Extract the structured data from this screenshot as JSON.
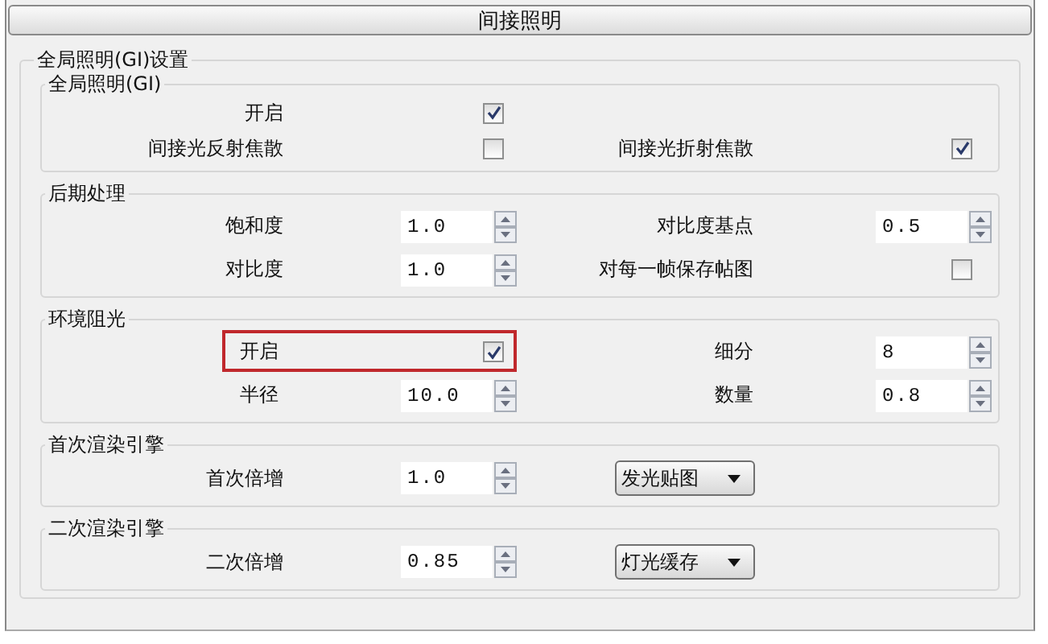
{
  "panel_title": "间接照明",
  "settings": {
    "title": "全局照明(GI)设置",
    "groups": [
      {
        "title": "全局照明(GI)",
        "rows": [
          {
            "left": {
              "label": "开启",
              "kind": "checkbox",
              "checked": true
            }
          },
          {
            "left": {
              "label": "间接光反射焦散",
              "kind": "checkbox",
              "checked": false
            },
            "right": {
              "label": "间接光折射焦散",
              "kind": "checkbox",
              "checked": true
            }
          }
        ]
      },
      {
        "title": "后期处理",
        "rows": [
          {
            "left": {
              "label": "饱和度",
              "kind": "spinner",
              "value": "1.0"
            },
            "right": {
              "label": "对比度基点",
              "kind": "spinner",
              "value": "0.5"
            }
          },
          {
            "left": {
              "label": "对比度",
              "kind": "spinner",
              "value": "1.0"
            },
            "right": {
              "label": "对每一帧保存帖图",
              "kind": "checkbox",
              "checked": false
            }
          }
        ]
      },
      {
        "title": "环境阻光",
        "rows": [
          {
            "highlighted": true,
            "left": {
              "label": "开启",
              "kind": "checkbox",
              "checked": true
            },
            "right": {
              "label": "细分",
              "kind": "spinner",
              "value": "8"
            }
          },
          {
            "highlighted": false,
            "left": {
              "label": "半径",
              "kind": "spinner",
              "value": "10.0"
            },
            "right": {
              "label": "数量",
              "kind": "spinner",
              "value": "0.8"
            }
          }
        ]
      },
      {
        "title": "首次渲染引擎",
        "rows": [
          {
            "left": {
              "label": "首次倍增",
              "kind": "spinner",
              "value": "1.0"
            },
            "right": {
              "kind": "dropdown",
              "value": "发光贴图"
            }
          }
        ]
      },
      {
        "title": "二次渲染引擎",
        "rows": [
          {
            "left": {
              "label": "二次倍增",
              "kind": "spinner",
              "value": "0.85"
            },
            "right": {
              "kind": "dropdown",
              "value": "灯光缓存"
            }
          }
        ]
      }
    ]
  }
}
